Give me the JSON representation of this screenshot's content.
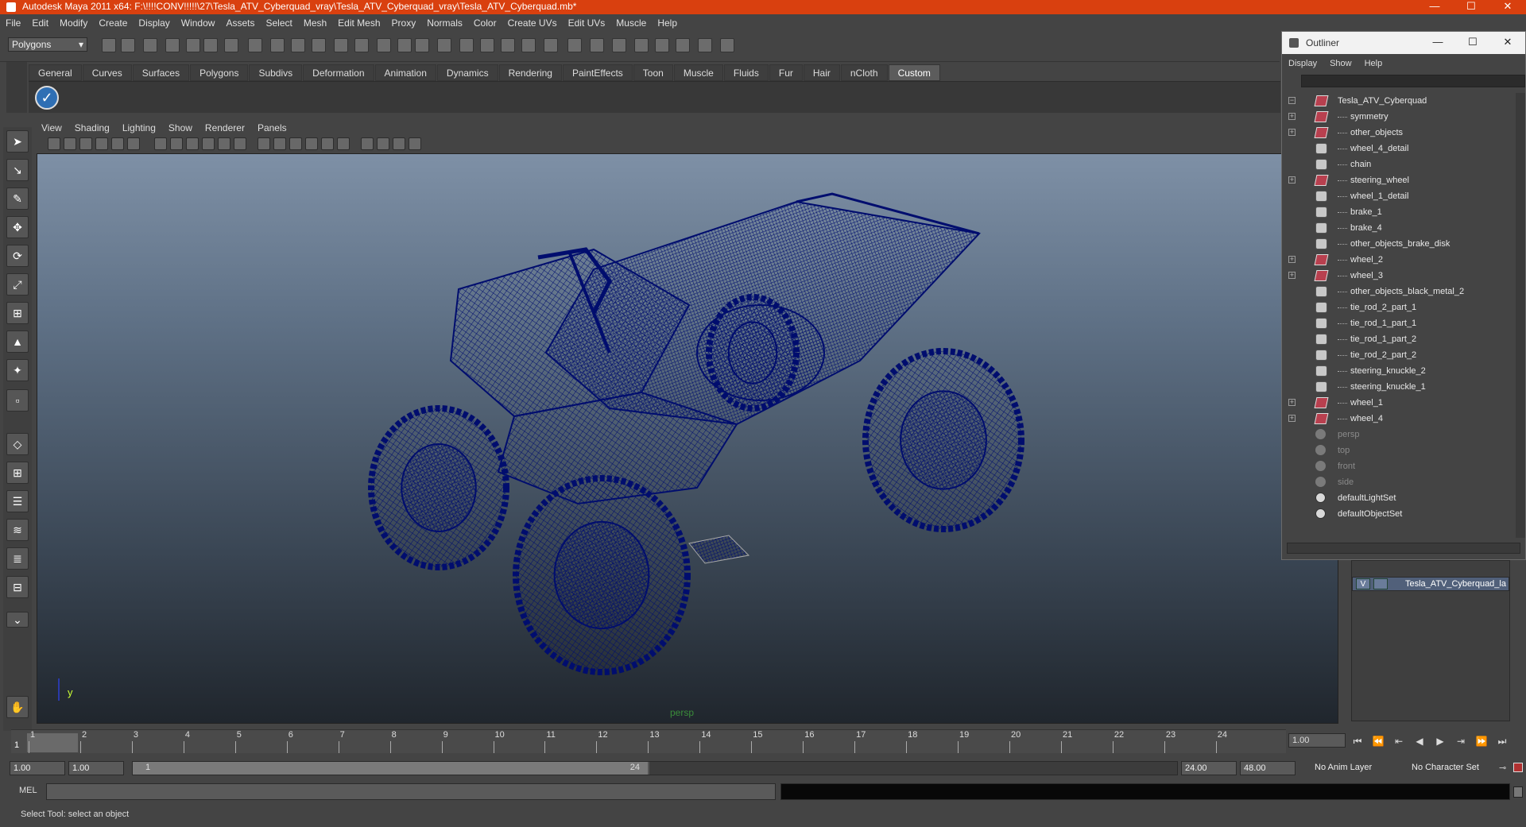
{
  "window": {
    "title": "Autodesk Maya 2011 x64: F:\\!!!!CONV!!!!!\\27\\Tesla_ATV_Cyberquad_vray\\Tesla_ATV_Cyberquad_vray\\Tesla_ATV_Cyberquad.mb*",
    "minimize": "—",
    "maximize": "☐",
    "close": "✕"
  },
  "menubar": [
    "File",
    "Edit",
    "Modify",
    "Create",
    "Display",
    "Window",
    "Assets",
    "Select",
    "Mesh",
    "Edit Mesh",
    "Proxy",
    "Normals",
    "Color",
    "Create UVs",
    "Edit UVs",
    "Muscle",
    "Help"
  ],
  "toolbar": {
    "mode": "Polygons"
  },
  "shelf": {
    "tabs": [
      "General",
      "Curves",
      "Surfaces",
      "Polygons",
      "Subdivs",
      "Deformation",
      "Animation",
      "Dynamics",
      "Rendering",
      "PaintEffects",
      "Toon",
      "Muscle",
      "Fluids",
      "Fur",
      "Hair",
      "nCloth",
      "Custom"
    ],
    "active_tab": "Custom"
  },
  "panel": {
    "menus": [
      "View",
      "Shading",
      "Lighting",
      "Show",
      "Renderer",
      "Panels"
    ],
    "camera_label": "persp",
    "axis_label": "y"
  },
  "outliner": {
    "title": "Outliner",
    "menus": [
      "Display",
      "Show",
      "Help"
    ],
    "items": [
      {
        "label": "Tesla_ATV_Cyberquad",
        "icon": "mesh",
        "expand": "−",
        "indent": 0,
        "dim": false
      },
      {
        "label": "symmetry",
        "icon": "mesh",
        "expand": "+",
        "indent": 1,
        "dim": false
      },
      {
        "label": "other_objects",
        "icon": "mesh",
        "expand": "+",
        "indent": 1,
        "dim": false
      },
      {
        "label": "wheel_4_detail",
        "icon": "grp",
        "expand": "",
        "indent": 1,
        "dim": false
      },
      {
        "label": "chain",
        "icon": "grp",
        "expand": "",
        "indent": 1,
        "dim": false
      },
      {
        "label": "steering_wheel",
        "icon": "mesh",
        "expand": "+",
        "indent": 1,
        "dim": false
      },
      {
        "label": "wheel_1_detail",
        "icon": "grp",
        "expand": "",
        "indent": 1,
        "dim": false
      },
      {
        "label": "brake_1",
        "icon": "grp",
        "expand": "",
        "indent": 1,
        "dim": false
      },
      {
        "label": "brake_4",
        "icon": "grp",
        "expand": "",
        "indent": 1,
        "dim": false
      },
      {
        "label": "other_objects_brake_disk",
        "icon": "grp",
        "expand": "",
        "indent": 1,
        "dim": false
      },
      {
        "label": "wheel_2",
        "icon": "mesh",
        "expand": "+",
        "indent": 1,
        "dim": false
      },
      {
        "label": "wheel_3",
        "icon": "mesh",
        "expand": "+",
        "indent": 1,
        "dim": false
      },
      {
        "label": "other_objects_black_metal_2",
        "icon": "grp",
        "expand": "",
        "indent": 1,
        "dim": false
      },
      {
        "label": "tie_rod_2_part_1",
        "icon": "grp",
        "expand": "",
        "indent": 1,
        "dim": false
      },
      {
        "label": "tie_rod_1_part_1",
        "icon": "grp",
        "expand": "",
        "indent": 1,
        "dim": false
      },
      {
        "label": "tie_rod_1_part_2",
        "icon": "grp",
        "expand": "",
        "indent": 1,
        "dim": false
      },
      {
        "label": "tie_rod_2_part_2",
        "icon": "grp",
        "expand": "",
        "indent": 1,
        "dim": false
      },
      {
        "label": "steering_knuckle_2",
        "icon": "grp",
        "expand": "",
        "indent": 1,
        "dim": false
      },
      {
        "label": "steering_knuckle_1",
        "icon": "grp",
        "expand": "",
        "indent": 1,
        "dim": false
      },
      {
        "label": "wheel_1",
        "icon": "mesh",
        "expand": "+",
        "indent": 1,
        "dim": false
      },
      {
        "label": "wheel_4",
        "icon": "mesh",
        "expand": "+",
        "indent": 1,
        "dim": false
      },
      {
        "label": "persp",
        "icon": "cam",
        "expand": "",
        "indent": 0,
        "dim": true
      },
      {
        "label": "top",
        "icon": "cam",
        "expand": "",
        "indent": 0,
        "dim": true
      },
      {
        "label": "front",
        "icon": "cam",
        "expand": "",
        "indent": 0,
        "dim": true
      },
      {
        "label": "side",
        "icon": "cam",
        "expand": "",
        "indent": 0,
        "dim": true
      },
      {
        "label": "defaultLightSet",
        "icon": "set",
        "expand": "",
        "indent": 0,
        "dim": false
      },
      {
        "label": "defaultObjectSet",
        "icon": "set",
        "expand": "",
        "indent": 0,
        "dim": false
      }
    ]
  },
  "layers": {
    "visible": "V",
    "name": "Tesla_ATV_Cyberquad_la"
  },
  "timeline": {
    "ticks": [
      1,
      2,
      3,
      4,
      5,
      6,
      7,
      8,
      9,
      10,
      11,
      12,
      13,
      14,
      15,
      16,
      17,
      18,
      19,
      20,
      21,
      22,
      23,
      24
    ],
    "current_frame": "1",
    "frame_field": "1.00"
  },
  "range": {
    "start": "1.00",
    "start_inner": "1.00",
    "slider_start": "1",
    "slider_end": "24",
    "end_inner": "24.00",
    "end": "48.00",
    "anim_layer": "No Anim Layer",
    "character_set": "No Character Set"
  },
  "mel": {
    "label": "MEL"
  },
  "help_line": "Select Tool: select an object",
  "colors": {
    "wireframe": "#000d6e",
    "accent": "#d9400f"
  }
}
